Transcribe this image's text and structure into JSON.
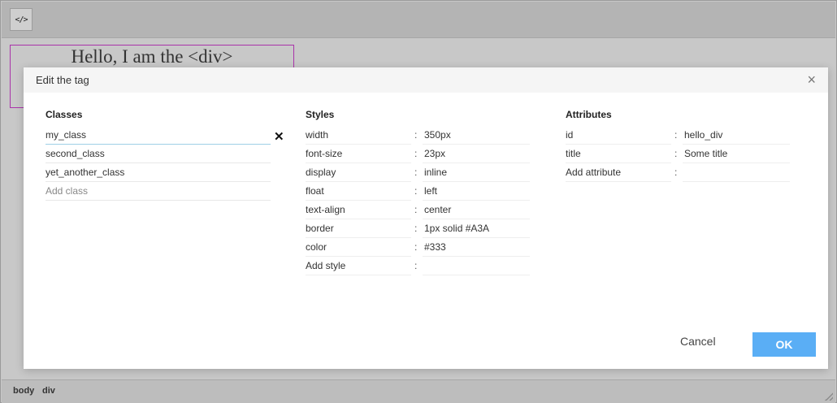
{
  "toolbar": {
    "source_icon": "</>"
  },
  "editor": {
    "div_text": "Hello, I am the <div>"
  },
  "statusbar": {
    "path": [
      "body",
      "div"
    ]
  },
  "dialog": {
    "title": "Edit the tag",
    "close": "×",
    "classes": {
      "header": "Classes",
      "items": [
        "my_class",
        "second_class",
        "yet_another_class"
      ],
      "add_placeholder": "Add class",
      "remove_icon": "✕"
    },
    "styles": {
      "header": "Styles",
      "items": [
        {
          "key": "width",
          "value": "350px"
        },
        {
          "key": "font-size",
          "value": "23px"
        },
        {
          "key": "display",
          "value": "inline"
        },
        {
          "key": "float",
          "value": "left"
        },
        {
          "key": "text-align",
          "value": "center"
        },
        {
          "key": "border",
          "value": "1px solid #A3A"
        },
        {
          "key": "color",
          "value": "#333"
        }
      ],
      "add_placeholder": "Add style"
    },
    "attributes": {
      "header": "Attributes",
      "items": [
        {
          "key": "id",
          "value": "hello_div"
        },
        {
          "key": "title",
          "value": "Some title"
        }
      ],
      "add_placeholder": "Add attribute"
    },
    "separator": ":",
    "cancel_label": "Cancel",
    "ok_label": "OK"
  },
  "colors": {
    "accent": "#5aaef5",
    "div_border": "#A3A"
  }
}
